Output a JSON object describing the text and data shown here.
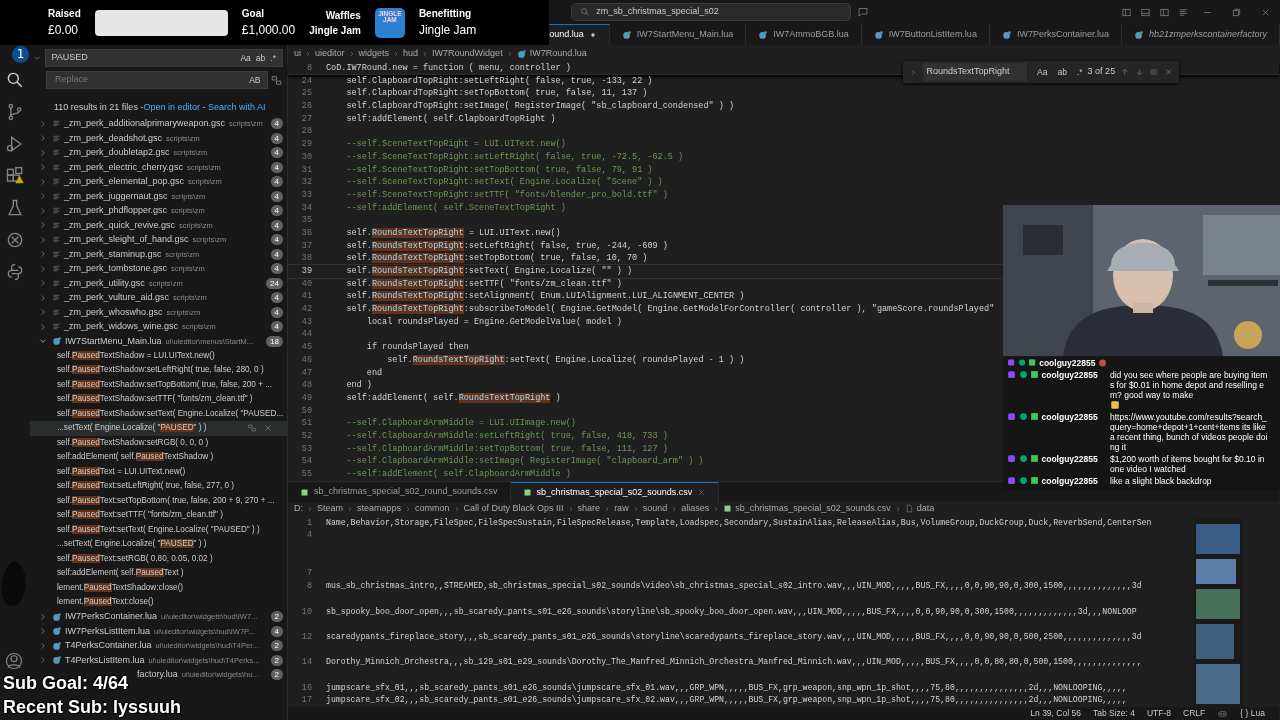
{
  "stream": {
    "raised_label": "Raised",
    "raised": "£0.00",
    "progress": {
      "level": 0
    },
    "goal_label": "Goal",
    "goal": "£1,000.00",
    "sponsor": "Waffles",
    "sponsor_sub": "Jingle Jam",
    "logo_text": "JINGLE JAM",
    "benefit_label": "Benefitting",
    "benefit": "Jingle Jam"
  },
  "title_search": "zm_sb_christmas_special_s02",
  "tabs": [
    {
      "label": "ound.lua",
      "selected": true,
      "modified": true,
      "preview": false
    },
    {
      "label": "IW7StartMenu_Main.lua",
      "selected": false,
      "modified": false,
      "preview": false
    },
    {
      "label": "IW7AmmoBGB.lua",
      "selected": false,
      "modified": false,
      "preview": false
    },
    {
      "label": "IW7ButtonListItem.lua",
      "selected": false,
      "modified": false,
      "preview": false
    },
    {
      "label": "IW7PerksContainer.lua",
      "selected": false,
      "modified": false,
      "preview": false
    },
    {
      "label": "hb21zmperkscontainerfactory",
      "selected": false,
      "modified": false,
      "preview": true
    }
  ],
  "activity_badge": "1",
  "sidebar": {
    "query": "PAUSED",
    "toggles": [
      "Aa",
      "ab",
      ".*"
    ],
    "replace_placeholder": "Replace",
    "replace_toggle": "AB",
    "summary": "110 results in 21 files - ",
    "links": [
      "Open in editor",
      "Search with AI"
    ],
    "link_separator": " - ",
    "results": [
      {
        "kind": "gsc",
        "name": "_zm_perk_additionalprimaryweapon.gsc",
        "path": "scripts\\zm",
        "count": "4",
        "expanded": false
      },
      {
        "kind": "gsc",
        "name": "_zm_perk_deadshot.gsc",
        "path": "scripts\\zm",
        "count": "4",
        "expanded": false
      },
      {
        "kind": "gsc",
        "name": "_zm_perk_doubletap2.gsc",
        "path": "scripts\\zm",
        "count": "4",
        "expanded": false
      },
      {
        "kind": "gsc",
        "name": "_zm_perk_electric_cherry.gsc",
        "path": "scripts\\zm",
        "count": "4",
        "expanded": false
      },
      {
        "kind": "gsc",
        "name": "_zm_perk_elemental_pop.gsc",
        "path": "scripts\\zm",
        "count": "4",
        "expanded": false
      },
      {
        "kind": "gsc",
        "name": "_zm_perk_juggernaut.gsc",
        "path": "scripts\\zm",
        "count": "4",
        "expanded": false
      },
      {
        "kind": "gsc",
        "name": "_zm_perk_phdflopper.gsc",
        "path": "scripts\\zm",
        "count": "4",
        "expanded": false
      },
      {
        "kind": "gsc",
        "name": "_zm_perk_quick_revive.gsc",
        "path": "scripts\\zm",
        "count": "4",
        "expanded": false
      },
      {
        "kind": "gsc",
        "name": "_zm_perk_sleight_of_hand.gsc",
        "path": "scripts\\zm",
        "count": "4",
        "expanded": false
      },
      {
        "kind": "gsc",
        "name": "_zm_perk_staminup.gsc",
        "path": "scripts\\zm",
        "count": "4",
        "expanded": false
      },
      {
        "kind": "gsc",
        "name": "_zm_perk_tombstone.gsc",
        "path": "scripts\\zm",
        "count": "4",
        "expanded": false
      },
      {
        "kind": "gsc",
        "name": "_zm_perk_utility.gsc",
        "path": "scripts\\zm",
        "count": "24",
        "expanded": false
      },
      {
        "kind": "gsc",
        "name": "_zm_perk_vulture_aid.gsc",
        "path": "scripts\\zm",
        "count": "4",
        "expanded": false
      },
      {
        "kind": "gsc",
        "name": "_zm_perk_whoswho.gsc",
        "path": "scripts\\zm",
        "count": "4",
        "expanded": false
      },
      {
        "kind": "gsc",
        "name": "_zm_perk_widows_wine.gsc",
        "path": "scripts\\zm",
        "count": "4",
        "expanded": false
      },
      {
        "kind": "lua",
        "name": "IW7StartMenu_Main.lua",
        "path": "ui\\uieditor\\menus\\StartM...",
        "count": "18",
        "expanded": true,
        "children": [
          {
            "pre": "self.",
            "match": "Paused",
            "post": "TextShadow = LUI.UIText.new()",
            "selected": false
          },
          {
            "pre": "self.",
            "match": "Paused",
            "post": "TextShadow:setLeftRight( true, false, 280, 0 )",
            "selected": false
          },
          {
            "pre": "self.",
            "match": "Paused",
            "post": "TextShadow:setTopBottom( true, false, 200 + ...",
            "selected": false
          },
          {
            "pre": "self.",
            "match": "Paused",
            "post": "TextShadow:setTTF( \"fonts/zm_clean.ttf\" )",
            "selected": false
          },
          {
            "pre": "self.",
            "match": "Paused",
            "post": "TextShadow:setText( Engine.Localize( \"PAUSED...",
            "selected": false
          },
          {
            "pre": "...setText( Engine.Localize( \"",
            "match": "PAUSED",
            "post": "\" ) )",
            "selected": true
          },
          {
            "pre": "self.",
            "match": "Paused",
            "post": "TextShadow:setRGB( 0, 0, 0 )",
            "selected": false
          },
          {
            "pre": "self:addElement( self.",
            "match": "Paused",
            "post": "TextShadow )",
            "selected": false
          },
          {
            "pre": "self.",
            "match": "Paused",
            "post": "Text = LUI.UIText.new()",
            "selected": false
          },
          {
            "pre": "self.",
            "match": "Paused",
            "post": "Text:setLeftRight( true, false, 277, 0 )",
            "selected": false
          },
          {
            "pre": "self.",
            "match": "Paused",
            "post": "Text:setTopBottom( true, false, 200 + 9, 270 + ...",
            "selected": false
          },
          {
            "pre": "self.",
            "match": "Paused",
            "post": "Text:setTTF( \"fonts/zm_clean.ttf\" )",
            "selected": false
          },
          {
            "pre": "self.",
            "match": "Paused",
            "post": "Text:setText( Engine.Localize( \"PAUSED\" ) )",
            "selected": false
          },
          {
            "pre": "...setText( Engine.Localize( \"",
            "match": "PAUSED",
            "post": "\" ) )",
            "selected": false
          },
          {
            "pre": "self.",
            "match": "Paused",
            "post": "Text:setRGB( 0.80, 0.05, 0.02 )",
            "selected": false
          },
          {
            "pre": "self:addElement( self.",
            "match": "Paused",
            "post": "Text )",
            "selected": false
          },
          {
            "pre": "lement.",
            "match": "Paused",
            "post": "TextShadow:close()",
            "selected": false
          },
          {
            "pre": "lement.",
            "match": "Paused",
            "post": "Text:close()",
            "selected": false
          }
        ]
      },
      {
        "kind": "lua",
        "name": "IW7PerksContainer.lua",
        "path": "ui\\uieditor\\widgets\\hud\\IW7...",
        "count": "2",
        "expanded": false
      },
      {
        "kind": "lua",
        "name": "IW7PerksListItem.lua",
        "path": "ui\\uieditor\\widgets\\hud\\IW7P...",
        "count": "4",
        "expanded": false
      },
      {
        "kind": "lua",
        "name": "T4PerksContainer.lua",
        "path": "ui\\uieditor\\widgets\\hud\\T4Per...",
        "count": "2",
        "expanded": false
      },
      {
        "kind": "lua",
        "name": "T4PerksListItem.lua",
        "path": "ui\\uieditor\\widgets\\hud\\T4Perks...",
        "count": "2",
        "expanded": false
      },
      {
        "kind": "partial",
        "name": "factory.lua",
        "path": "ui\\uieditor\\widgets\\hu...",
        "count": "2",
        "expanded": false
      }
    ]
  },
  "breadcrumb": [
    "ui",
    "uieditor",
    "widgets",
    "hud",
    "IW7RoundWidget",
    "IW7Round.lua"
  ],
  "sticky": {
    "n": "8",
    "text": "CoD.IW7Round.new = function ( menu, controller )"
  },
  "code": [
    {
      "n": "24",
      "kind": "code",
      "current": false,
      "text": "    self.ClapboardTopRight:setLeftRight( false, true, -133, 22 )"
    },
    {
      "n": "25",
      "kind": "code",
      "current": false,
      "text": "    self.ClapboardTopRight:setTopBottom( true, false, 11, 137 )"
    },
    {
      "n": "26",
      "kind": "code",
      "current": false,
      "text": "    self.ClapboardTopRight:setImage( RegisterImage( \"sb_clapboard_condensed\" ) )"
    },
    {
      "n": "27",
      "kind": "code",
      "current": false,
      "text": "    self:addElement( self.ClapboardTopRight )"
    },
    {
      "n": "28",
      "current": false
    },
    {
      "n": "29",
      "kind": "comment",
      "current": false,
      "text": "    --self.SceneTextTopRight = LUI.UIText.new()"
    },
    {
      "n": "30",
      "kind": "comment",
      "current": false,
      "text": "    --self.SceneTextTopRight:setLeftRight( false, true, -72.5, -62.5 )"
    },
    {
      "n": "31",
      "kind": "comment",
      "current": false,
      "text": "    --self.SceneTextTopRight:setTopBottom( true, false, 79, 91 )"
    },
    {
      "n": "32",
      "kind": "comment",
      "current": false,
      "text": "    --self.SceneTextTopRight:setText( Engine.Localize( \"Scene\" ) )"
    },
    {
      "n": "33",
      "kind": "comment",
      "current": false,
      "text": "    --self.SceneTextTopRight:setTTF( \"fonts/blender_pro_bold.ttf\" )"
    },
    {
      "n": "34",
      "kind": "comment",
      "current": false,
      "text": "    --self:addElement( self.SceneTextTopRight )"
    },
    {
      "n": "35",
      "current": false
    },
    {
      "n": "36",
      "kind": "code",
      "current": false,
      "pre": "    self.",
      "match": "RoundsTextTopRight",
      "post": " = LUI.UIText.new()"
    },
    {
      "n": "37",
      "kind": "code",
      "current": false,
      "pre": "    self.",
      "match": "RoundsTextTopRight",
      "post": ":setLeftRight( false, true, -244, -609 )"
    },
    {
      "n": "38",
      "kind": "code",
      "current": false,
      "pre": "    self.",
      "match": "RoundsTextTopRight",
      "post": ":setTopBottom( true, false, 10, 70 )"
    },
    {
      "n": "39",
      "kind": "code",
      "current": true,
      "pre": "    self.",
      "match": "RoundsTextTopRight",
      "post": ":setText( Engine.Localize( \"\" ) )"
    },
    {
      "n": "40",
      "kind": "code",
      "current": false,
      "pre": "    self.",
      "match": "RoundsTextTopRight",
      "post": ":setTTF( \"fonts/zm_clean.ttf\" )"
    },
    {
      "n": "41",
      "kind": "code",
      "current": false,
      "pre": "    self.",
      "match": "RoundsTextTopRight",
      "post": ":setAlignment( Enum.LUIAlignment.LUI_ALIGNMENT_CENTER )"
    },
    {
      "n": "42",
      "kind": "code",
      "current": false,
      "pre": "    self.",
      "match": "RoundsTextTopRight",
      "post": ":subscribeToModel( Engine.GetModel( Engine.GetModelForController( controller ), \"gameScore.roundsPlayed\""
    },
    {
      "n": "43",
      "kind": "code",
      "current": false,
      "text": "        local roundsPlayed = Engine.GetModelValue( model )"
    },
    {
      "n": "44",
      "current": false
    },
    {
      "n": "45",
      "kind": "code",
      "current": false,
      "text": "        if roundsPlayed then"
    },
    {
      "n": "46",
      "kind": "code",
      "current": false,
      "pre": "            self.",
      "match": "RoundsTextTopRight",
      "post": ":setText( Engine.Localize( roundsPlayed - 1 ) )"
    },
    {
      "n": "47",
      "kind": "code",
      "current": false,
      "text": "        end"
    },
    {
      "n": "48",
      "kind": "code",
      "current": false,
      "text": "    end )"
    },
    {
      "n": "49",
      "kind": "code",
      "current": false,
      "pre": "    self:addElement( self.",
      "match": "RoundsTextTopRight",
      "post": " )"
    },
    {
      "n": "50",
      "current": false
    },
    {
      "n": "51",
      "kind": "comment",
      "current": false,
      "text": "    --self.ClapboardArmMiddle = LUI.UIImage.new()"
    },
    {
      "n": "52",
      "kind": "comment",
      "current": false,
      "text": "    --self.ClapboardArmMiddle:setLeftRight( true, false, 418, 733 )"
    },
    {
      "n": "53",
      "kind": "comment",
      "current": false,
      "text": "    --self.ClapboardArmMiddle:setTopBottom( true, false, 111, 127 )"
    },
    {
      "n": "54",
      "kind": "comment",
      "current": false,
      "text": "    --self.ClapboardArmMiddle:setImage( RegisterImage( \"clapboard_arm\" ) )"
    },
    {
      "n": "55",
      "kind": "comment",
      "current": false,
      "text": "    --self:addElement( self.ClapboardArmMiddle )"
    }
  ],
  "find": {
    "query": "RoundsTextTopRight",
    "toggles": [
      "Aa",
      "ab",
      ".*"
    ],
    "count": "3 of 25"
  },
  "bottom_tabs": [
    {
      "label": "sb_christmas_special_s02_round_sounds.csv",
      "selected": false
    },
    {
      "label": "sb_christmas_special_s02_sounds.csv",
      "selected": true
    }
  ],
  "bottom_breadcrumb": [
    "D:",
    "Steam",
    "steamapps",
    "common",
    "Call of Duty Black Ops III",
    "share",
    "raw",
    "sound",
    "aliases",
    "sb_christmas_special_s02_sounds.csv",
    "data"
  ],
  "csv": [
    {
      "kind": "line",
      "n": "1",
      "text": "Name,Behavior,Storage,FileSpec,FileSpecSustain,FileSpecRelease,Template,Loadspec,Secondary,SustainAlias,ReleaseAlias,Bus,VolumeGroup,DuckGroup,Duck,ReverbSend,CenterSen"
    },
    {
      "kind": "line",
      "n": "4"
    },
    {
      "kind": "blank"
    },
    {
      "kind": "blank"
    },
    {
      "kind": "line",
      "n": "7"
    },
    {
      "kind": "line",
      "n": "8",
      "text": "mus_sb_christmas_intro,,STREAMED,sb_christmas_special_s02_sounds\\video\\sb_christmas_special_s02_intro.wav,,,UIN_MOD,,,,,BUS_FX,,,,0,0,90,90,0,300,1500,,,,,,,,,,,,,,3d"
    },
    {
      "kind": "blank"
    },
    {
      "kind": "line",
      "n": "10",
      "text": "sb_spooky_boo_door_open,,,sb_scaredy_pants_s01_e26_sounds\\storyline\\sb_spooky_boo_door_open.wav,,,UIN_MOD,,,,,BUS_FX,,,,0,0,90,90,0,300,1500,,,,,,,,,,,,,3d,,,NONLOOP"
    },
    {
      "kind": "blank"
    },
    {
      "kind": "line",
      "n": "12",
      "text": "scaredypants_fireplace_story,,,sb_scaredy_pants_s01_e26_sounds\\storyline\\scaredypants_fireplace_story.wav,,,UIN_MOD,,,,,BUS_FX,,,,0,0,90,90,0,500,2500,,,,,,,,,,,,,,3d"
    },
    {
      "kind": "blank"
    },
    {
      "kind": "line",
      "n": "14",
      "text": "Dorothy_Minnich_Orchestra,,,sb_129_s01_e29_sounds\\Dorothy_The_Manfred_Minnich_Orchestra_Manfred_Minnich.wav,,,UIN_MOD,,,,,BUS_FX,,,,0,0,80,80,0,500,1500,,,,,,,,,,,,,,"
    },
    {
      "kind": "blank"
    },
    {
      "kind": "line",
      "n": "16",
      "text": "jumpscare_sfx_01,,,sb_scaredy_pants_s01_e26_sounds\\jumpscare_sfx_01.wav,,,GRP_WPN,,,,,BUS_FX,grp_weapon,snp_wpn_1p_shot,,,,75,80,,,,,,,,,,,,,,,2d,,,NONLOOPING,,,,,"
    },
    {
      "kind": "line",
      "n": "17",
      "text": "jumpscare_sfx_02,,,sb_scaredy_pants_s01_e26_sounds\\jumpscare_sfx_02.wav,,,GRP_WPN,,,,,BUS_FX,grp_weapon,snp_wpn_1p_shot,,,,75,80,,,,,,,,,,,,,,,2d,,,NONLOOPING,,,,,"
    }
  ],
  "status": [
    "Ln 39, Col 56",
    "Tab Size: 4",
    "UTF-8",
    "CRLF"
  ],
  "status_lang_icon": "{ }",
  "status_lang": "Lua",
  "chat": [
    {
      "user": "coolguy22855",
      "emote": true
    },
    {
      "user": "coolguy22855",
      "text": "did you see where people are buying items for $0.01 in home depot and reselling em? good way to make",
      "emote": true
    },
    {
      "user": "coolguy22855",
      "text": "https://www.youtube.com/results?search_query=home+depot+1+cent+items its like a recent thing, bunch of videos people doing it",
      "emote": false
    },
    {
      "user": "coolguy22855",
      "text": "$1,200 worth of items bought for $0.10 in one video I watched",
      "emote": false
    },
    {
      "user": "coolguy22855",
      "text": "like a slight black backdrop",
      "emote": false
    }
  ],
  "webcam": {
    "kind": "picture"
  },
  "overlay": {
    "sub_goal": "Sub Goal: 4/64",
    "recent_sub": "Recent Sub: lyssuuh"
  }
}
